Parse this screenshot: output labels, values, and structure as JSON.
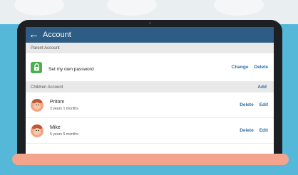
{
  "appbar": {
    "title": "Account",
    "back_icon": "arrow-left-icon"
  },
  "parent_section": {
    "header": "Parent Account",
    "password_row": {
      "label": "Set my own password",
      "icon": "lock-icon",
      "change_label": "Change",
      "delete_label": "Delete"
    }
  },
  "children_section": {
    "header": "Children Account",
    "add_label": "Add",
    "children": [
      {
        "name": "Pritom",
        "age": "3 years 1 months",
        "delete_label": "Delete",
        "edit_label": "Edit"
      },
      {
        "name": "Mike",
        "age": "5 years 5 months",
        "delete_label": "Delete",
        "edit_label": "Edit"
      }
    ]
  },
  "colors": {
    "appbar": "#2d5d84",
    "accent": "#2d6fa5",
    "lock": "#4caf50",
    "background": "#55b8d8",
    "bottom_bar": "#f2a48c"
  }
}
